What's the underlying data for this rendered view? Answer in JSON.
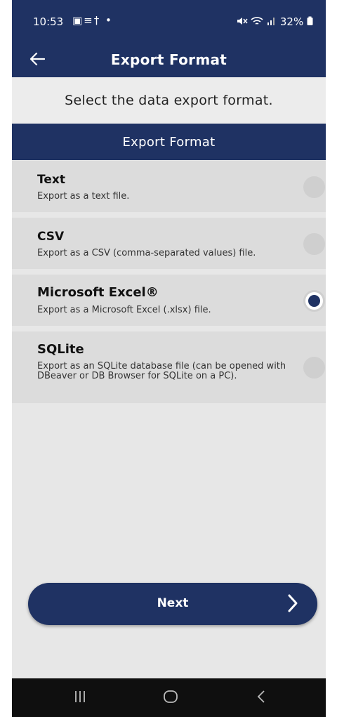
{
  "status_bar": {
    "time": "10:53",
    "left_icons": "▣≡† •",
    "battery": "32%"
  },
  "app_bar": {
    "title": "Export Format"
  },
  "instruction": "Select the data export format.",
  "section_header": "Export Format",
  "options": [
    {
      "title": "Text",
      "description": "Export as a text file.",
      "selected": false
    },
    {
      "title": "CSV",
      "description": "Export as a CSV (comma-separated values)  file.",
      "selected": false
    },
    {
      "title": "Microsoft Excel®",
      "description": "Export as a Microsoft Excel (.xlsx) file.",
      "selected": true
    },
    {
      "title": "SQLite",
      "description": "Export as an SQLite database file (can be opened with DBeaver or DB Browser for SQLite on a PC).",
      "selected": false
    }
  ],
  "next_button": {
    "label": "Next"
  },
  "colors": {
    "primary": "#1f3263",
    "background": "#e7e7e7",
    "option_bg": "#dcdcdc",
    "radio_off": "#cfcfcf"
  },
  "icons": [
    "back-arrow-icon",
    "wifi-icon",
    "signal-icon",
    "battery-icon",
    "mute-icon",
    "chevron-right-icon",
    "recent-apps-icon",
    "home-icon",
    "back-nav-icon"
  ]
}
